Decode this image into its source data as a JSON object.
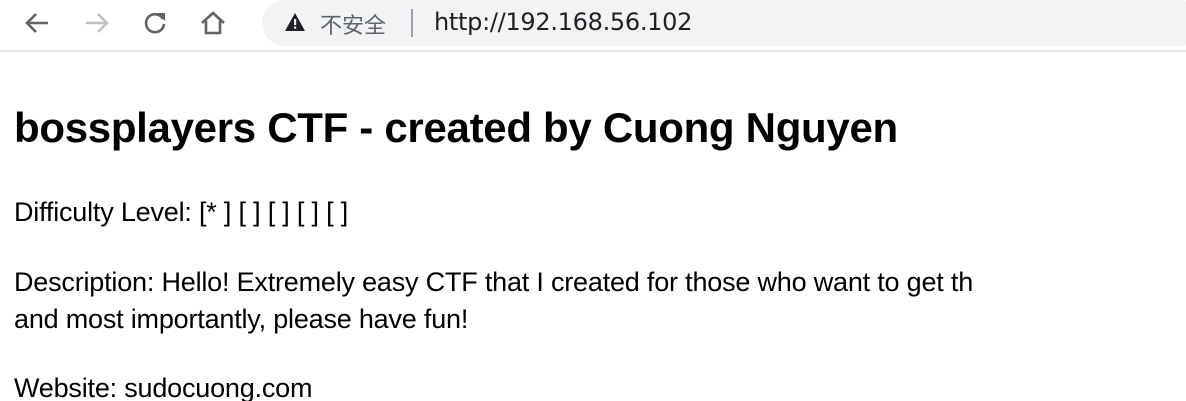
{
  "browser": {
    "security_label": "不安全",
    "url": "http://192.168.56.102",
    "icons": [
      "back-arrow-icon",
      "forward-arrow-icon",
      "reload-icon",
      "home-icon",
      "warning-icon"
    ]
  },
  "page": {
    "title": "bossplayers CTF - created by Cuong Nguyen",
    "difficulty": "Difficulty Level: [* ] [ ] [ ] [ ] [ ]",
    "description_line1": "Description: Hello! Extremely easy CTF that I created for those who want to get th",
    "description_line2": "and most importantly, please have fun!",
    "website": "Website: sudocuong.com"
  }
}
